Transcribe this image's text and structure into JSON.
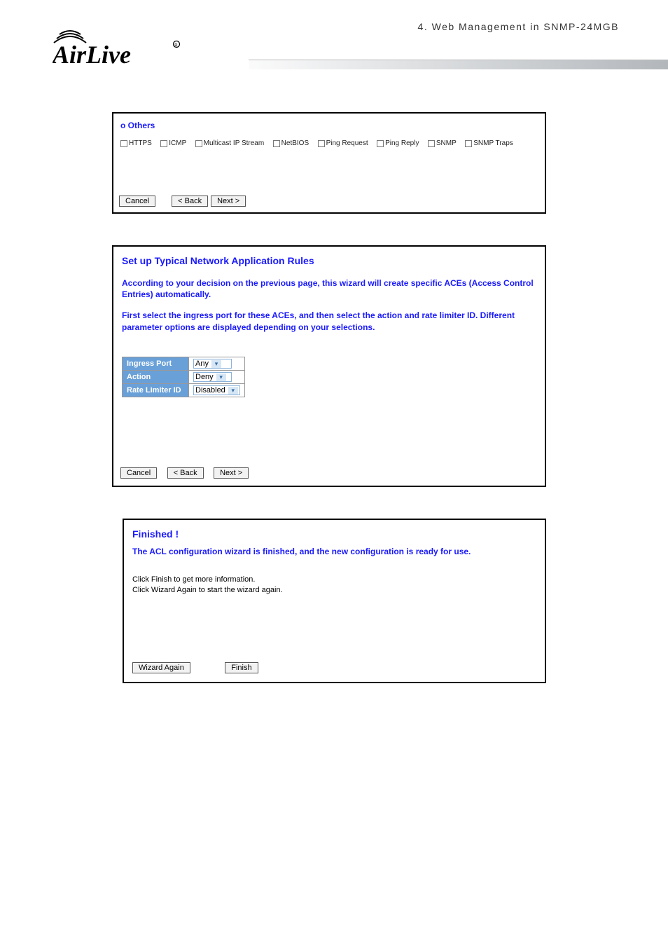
{
  "header": {
    "section_title": "4.   Web  Management  in  SNMP-24MGB"
  },
  "logo": {
    "brand": "AirLive"
  },
  "panel1": {
    "title": "o Others",
    "checkboxes": [
      "HTTPS",
      "ICMP",
      "Multicast IP Stream",
      "NetBIOS",
      "Ping Request",
      "Ping Reply",
      "SNMP",
      "SNMP Traps"
    ],
    "buttons": {
      "cancel": "Cancel",
      "back": "< Back",
      "next": "Next >"
    }
  },
  "panel2": {
    "title": "Set up Typical Network Application Rules",
    "desc1": "According to your decision on the previous page, this wizard will create specific ACEs (Access Control Entries) automatically.",
    "desc2": "First select the ingress port for these ACEs, and then select the action and rate limiter ID. Different parameter options are displayed depending on your selections.",
    "params": {
      "ingress_port": {
        "label": "Ingress Port",
        "value": "Any"
      },
      "action": {
        "label": "Action",
        "value": "Deny"
      },
      "rate_limiter": {
        "label": "Rate Limiter ID",
        "value": "Disabled"
      }
    },
    "buttons": {
      "cancel": "Cancel",
      "back": "< Back",
      "next": "Next >"
    }
  },
  "panel3": {
    "title": "Finished !",
    "subtitle": "The ACL configuration wizard is finished, and the new configuration is ready for use.",
    "info1": "Click Finish to get more information.",
    "info2": "Click Wizard Again to start the wizard again.",
    "buttons": {
      "wizard_again": "Wizard Again",
      "finish": "Finish"
    }
  }
}
